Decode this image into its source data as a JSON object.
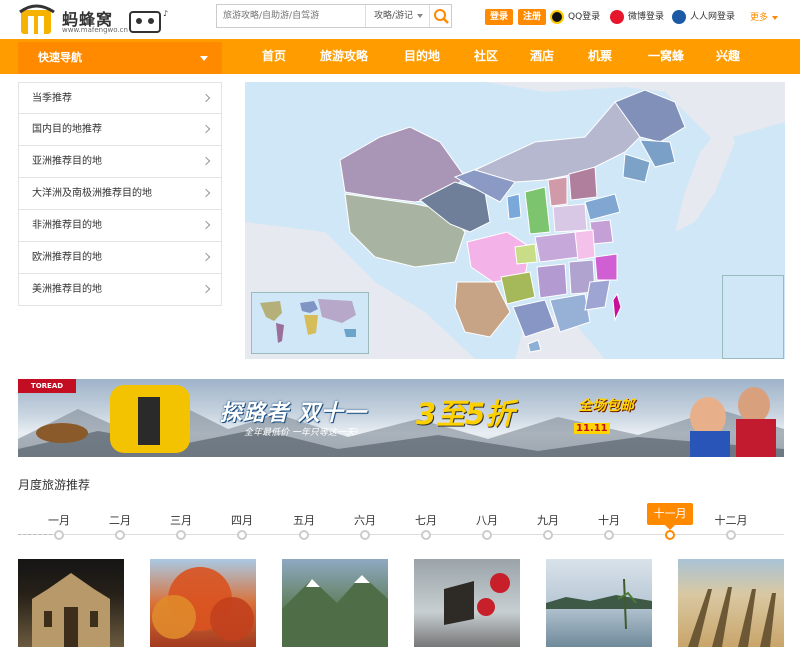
{
  "header": {
    "logo": {
      "brand": "蚂蜂窝",
      "site": "www.mafengwo.cn"
    },
    "search": {
      "placeholder": "旅游攻略/自助游/自驾游",
      "category": "攻略/游记"
    },
    "login_label": "登录",
    "register_label": "注册",
    "social": [
      {
        "label": "QQ登录",
        "icon": "qq-icon"
      },
      {
        "label": "微博登录",
        "icon": "weibo-icon"
      },
      {
        "label": "人人网登录",
        "icon": "renren-icon"
      }
    ],
    "more_label": "更多"
  },
  "nav": {
    "quick_label": "快速导航",
    "items": [
      "首页",
      "旅游攻略",
      "目的地",
      "社区",
      "酒店",
      "机票",
      "一窝蜂",
      "兴趣"
    ]
  },
  "sidebar": {
    "items": [
      "当季推荐",
      "国内目的地推荐",
      "亚洲推荐目的地",
      "大洋洲及南极洲推荐目的地",
      "非洲推荐目的地",
      "欧洲推荐目的地",
      "美洲推荐目的地"
    ]
  },
  "banner": {
    "brand": "TOREAD",
    "headline": "探路者",
    "headline2": "双十一",
    "promo": "3至5折",
    "freeship": "全场包邮",
    "subline": "全年最低价 一年只等这一天!",
    "date": "11.11"
  },
  "months": {
    "title": "月度旅游推荐",
    "items": [
      "一月",
      "二月",
      "三月",
      "四月",
      "五月",
      "六月",
      "七月",
      "八月",
      "九月",
      "十月",
      "十一月",
      "十二月"
    ],
    "active_index": 10
  },
  "colors": {
    "accent": "#ff8a00",
    "nav_bg": "#ff9d00",
    "map_sea": "#cfe7f7"
  }
}
